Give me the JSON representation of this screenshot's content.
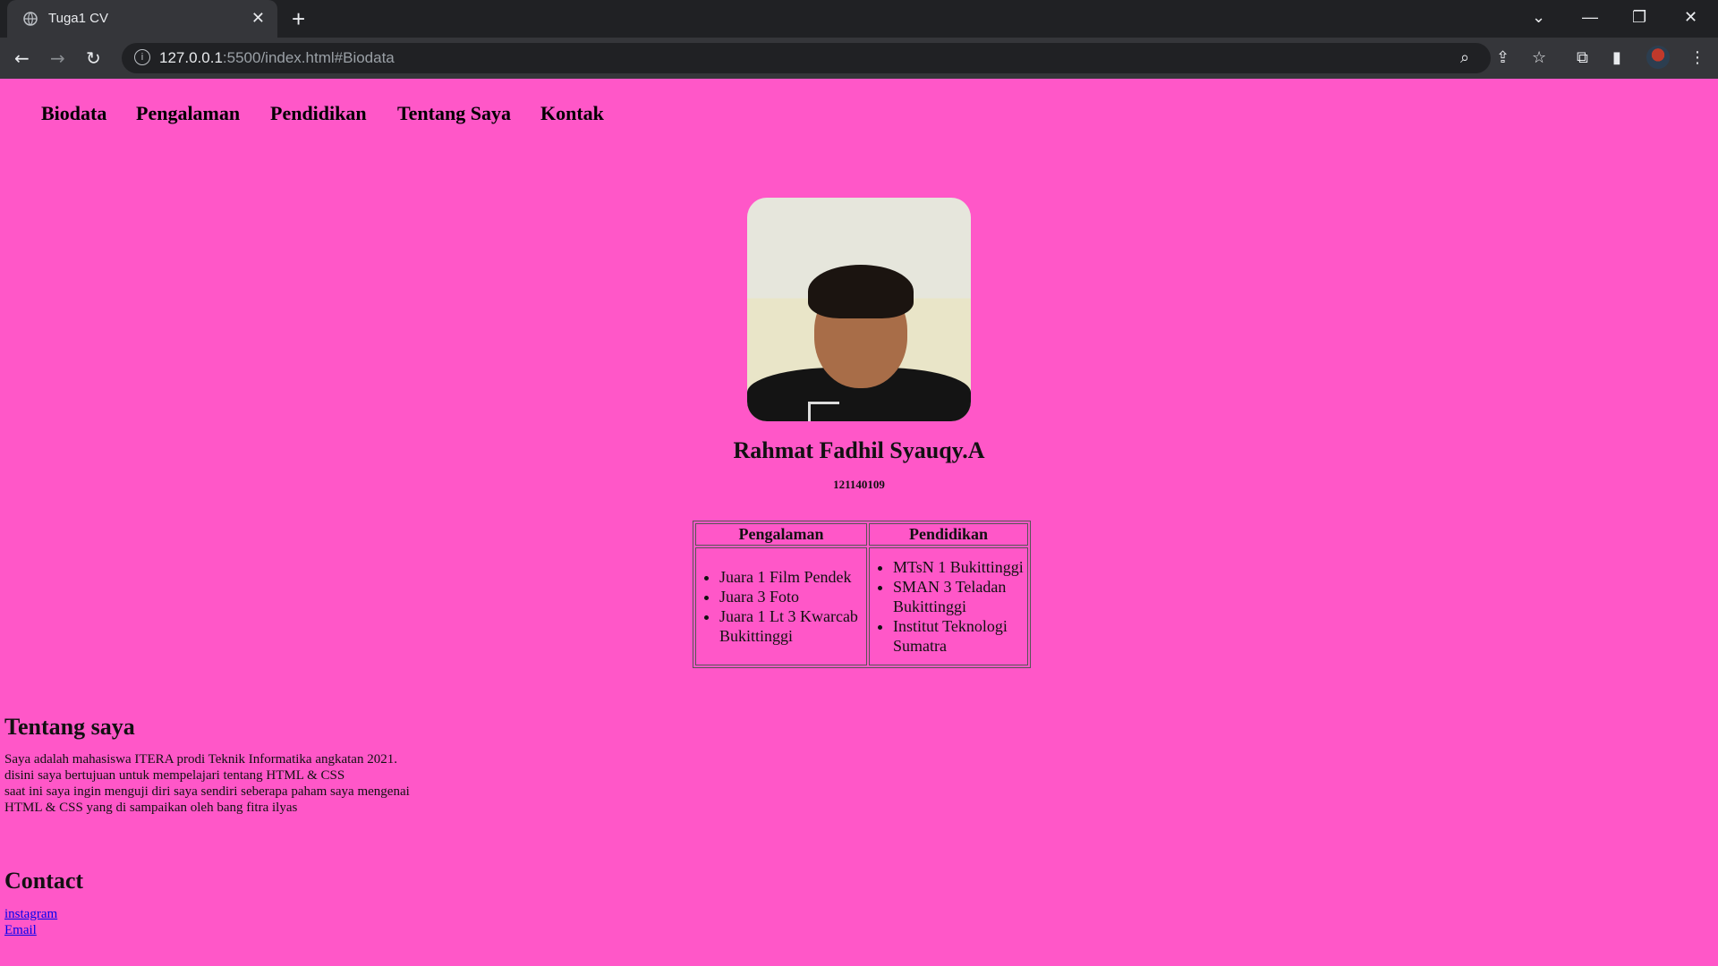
{
  "browser": {
    "tab_title": "Tuga1 CV",
    "url_host": "127.0.0.1",
    "url_rest": ":5500/index.html#Biodata"
  },
  "nav": [
    "Biodata",
    "Pengalaman",
    "Pendidikan",
    "Tentang Saya",
    "Kontak"
  ],
  "profile": {
    "name": "Rahmat Fadhil Syauqy.A",
    "nim": "121140109"
  },
  "table": {
    "headers": [
      "Pengalaman",
      "Pendidikan"
    ],
    "pengalaman": [
      "Juara 1 Film Pendek",
      "Juara 3 Foto",
      "Juara 1 Lt 3 Kwarcab Bukittinggi"
    ],
    "pendidikan": [
      "MTsN 1 Bukittinggi",
      "SMAN 3 Teladan Bukittinggi",
      "Institut Teknologi Sumatra"
    ]
  },
  "about": {
    "heading": "Tentang saya",
    "lines": [
      "Saya adalah mahasiswa ITERA prodi Teknik Informatika angkatan 2021.",
      "disini saya bertujuan untuk mempelajari tentang HTML & CSS",
      "saat ini saya ingin menguji diri saya sendiri seberapa paham saya mengenai",
      "HTML & CSS yang di sampaikan oleh bang fitra ilyas"
    ]
  },
  "contact": {
    "heading": "Contact",
    "links": [
      "instagram",
      "Email"
    ]
  },
  "colors": {
    "page_bg": "#ff57c8",
    "link": "#0000ee"
  }
}
